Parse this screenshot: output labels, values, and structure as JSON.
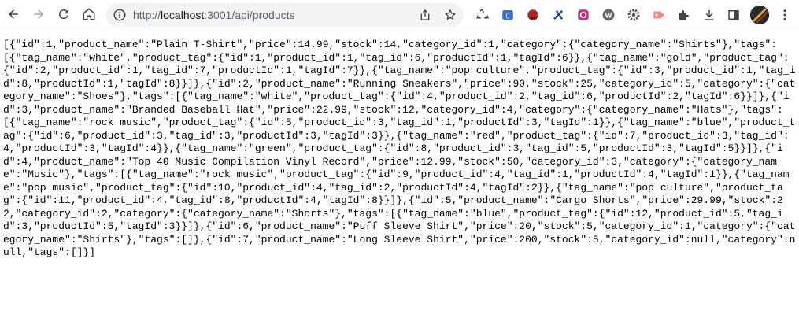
{
  "browser": {
    "url_prefix": "http://",
    "url_host": "localhost",
    "url_rest": ":3001/api/products"
  },
  "icons": {
    "back": "arrow-left-icon",
    "forward": "arrow-right-icon",
    "reload": "reload-icon",
    "home": "home-icon",
    "site_info": "info-icon",
    "share": "share-icon",
    "bookmark": "star-icon",
    "extensions": [
      "recycle-icon",
      "bracket-icon",
      "stamp-icon",
      "cross-icon",
      "camera-icon",
      "w-icon",
      "gear-icon",
      "tag-icon",
      "puzzle-icon"
    ],
    "download": "download-icon",
    "sidepanel": "sidepanel-icon",
    "menu": "kebab-menu-icon"
  },
  "json_body": "[{\"id\":1,\"product_name\":\"Plain T-Shirt\",\"price\":14.99,\"stock\":14,\"category_id\":1,\"category\":{\"category_name\":\"Shirts\"},\"tags\":[{\"tag_name\":\"white\",\"product_tag\":{\"id\":1,\"product_id\":1,\"tag_id\":6,\"productId\":1,\"tagId\":6}},{\"tag_name\":\"gold\",\"product_tag\":{\"id\":2,\"product_id\":1,\"tag_id\":7,\"productId\":1,\"tagId\":7}},{\"tag_name\":\"pop culture\",\"product_tag\":{\"id\":3,\"product_id\":1,\"tag_id\":8,\"productId\":1,\"tagId\":8}}]},{\"id\":2,\"product_name\":\"Running Sneakers\",\"price\":90,\"stock\":25,\"category_id\":5,\"category\":{\"category_name\":\"Shoes\"},\"tags\":[{\"tag_name\":\"white\",\"product_tag\":{\"id\":4,\"product_id\":2,\"tag_id\":6,\"productId\":2,\"tagId\":6}}]},{\"id\":3,\"product_name\":\"Branded Baseball Hat\",\"price\":22.99,\"stock\":12,\"category_id\":4,\"category\":{\"category_name\":\"Hats\"},\"tags\":[{\"tag_name\":\"rock music\",\"product_tag\":{\"id\":5,\"product_id\":3,\"tag_id\":1,\"productId\":3,\"tagId\":1}},{\"tag_name\":\"blue\",\"product_tag\":{\"id\":6,\"product_id\":3,\"tag_id\":3,\"productId\":3,\"tagId\":3}},{\"tag_name\":\"red\",\"product_tag\":{\"id\":7,\"product_id\":3,\"tag_id\":4,\"productId\":3,\"tagId\":4}},{\"tag_name\":\"green\",\"product_tag\":{\"id\":8,\"product_id\":3,\"tag_id\":5,\"productId\":3,\"tagId\":5}}]},{\"id\":4,\"product_name\":\"Top 40 Music Compilation Vinyl Record\",\"price\":12.99,\"stock\":50,\"category_id\":3,\"category\":{\"category_name\":\"Music\"},\"tags\":[{\"tag_name\":\"rock music\",\"product_tag\":{\"id\":9,\"product_id\":4,\"tag_id\":1,\"productId\":4,\"tagId\":1}},{\"tag_name\":\"pop music\",\"product_tag\":{\"id\":10,\"product_id\":4,\"tag_id\":2,\"productId\":4,\"tagId\":2}},{\"tag_name\":\"pop culture\",\"product_tag\":{\"id\":11,\"product_id\":4,\"tag_id\":8,\"productId\":4,\"tagId\":8}}]},{\"id\":5,\"product_name\":\"Cargo Shorts\",\"price\":29.99,\"stock\":22,\"category_id\":2,\"category\":{\"category_name\":\"Shorts\"},\"tags\":[{\"tag_name\":\"blue\",\"product_tag\":{\"id\":12,\"product_id\":5,\"tag_id\":3,\"productId\":5,\"tagId\":3}}]},{\"id\":6,\"product_name\":\"Puff Sleeve Shirt\",\"price\":20,\"stock\":5,\"category_id\":1,\"category\":{\"category_name\":\"Shirts\"},\"tags\":[]},{\"id\":7,\"product_name\":\"Long Sleeve Shirt\",\"price\":200,\"stock\":5,\"category_id\":null,\"category\":null,\"tags\":[]}]"
}
